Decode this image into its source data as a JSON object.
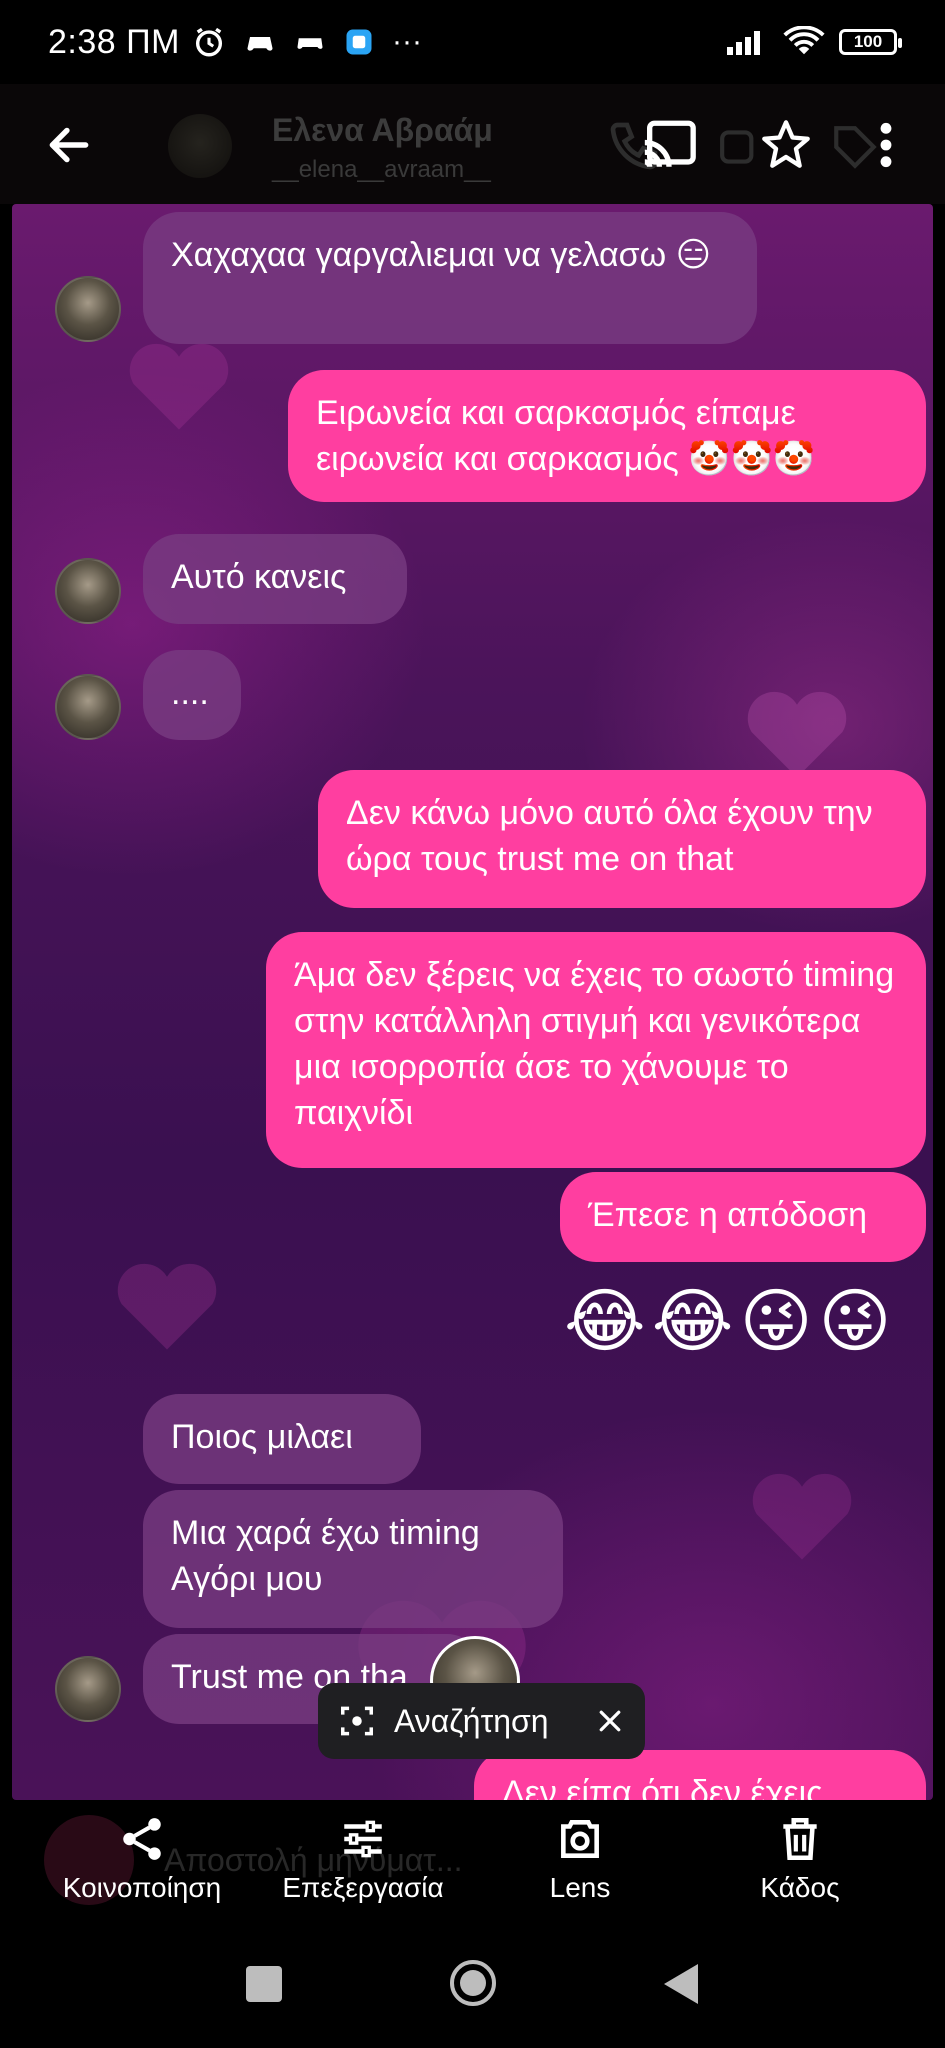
{
  "status_bar": {
    "time": "2:38 ΠΜ",
    "more": "···",
    "battery": "100"
  },
  "header": {
    "contact_name": "Ελενα Αβραάμ",
    "username": "__elena__avraam__"
  },
  "messages": [
    {
      "side": "in",
      "text": "Χαχαχαα γαργαλιεμαι να γελασω 😑"
    },
    {
      "side": "out",
      "text": "Ειρωνεία και σαρκασμός είπαμε ειρωνεία και σαρκασμός 🤡🤡🤡"
    },
    {
      "side": "in",
      "text": "Αυτό κανεις"
    },
    {
      "side": "in",
      "text": "...."
    },
    {
      "side": "out",
      "text": "Δεν κάνω μόνο αυτό όλα έχουν την ώρα τους trust me on that"
    },
    {
      "side": "out",
      "text": "Άμα δεν ξέρεις να έχεις το σωστό timing στην κατάλληλη στιγμή και γενικότερα μια ισορροπία άσε το χάνουμε το παιχνίδι"
    },
    {
      "side": "out",
      "text": "Έπεσε η απόδοση"
    },
    {
      "side": "out",
      "text": "😂😂😜😜"
    },
    {
      "side": "in",
      "text": "Ποιος μιλαει"
    },
    {
      "side": "in",
      "text": "Μια χαρά έχω timing Αγόρι μου"
    },
    {
      "side": "in",
      "text": "Trust me on tha"
    },
    {
      "side": "out",
      "text": "Δεν είπα ότι δεν έχεις"
    }
  ],
  "search_pill": {
    "label": "Αναζήτηση"
  },
  "composer": {
    "placeholder": "Αποστολή μηνύματ..."
  },
  "actions": [
    {
      "label": "Κοινοποίηση",
      "icon": "share-icon"
    },
    {
      "label": "Επεξεργασία",
      "icon": "sliders-icon"
    },
    {
      "label": "Lens",
      "icon": "lens-icon"
    },
    {
      "label": "Κάδος",
      "icon": "trash-icon"
    }
  ],
  "colors": {
    "outgoing_bubble": "#ff3ea0",
    "incoming_bubble": "#7a3c82",
    "background": "#4b145a"
  }
}
